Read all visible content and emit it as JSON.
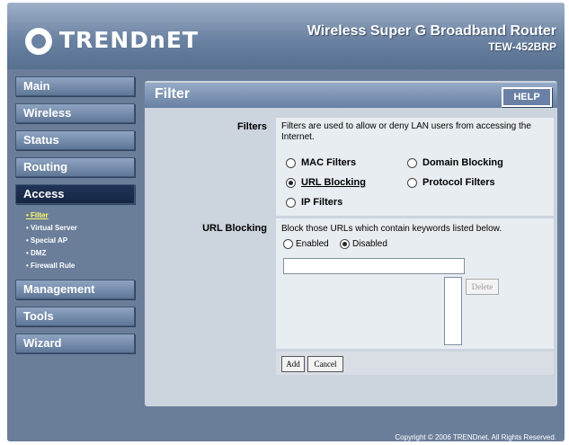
{
  "brand": {
    "logo": "TRENDnET",
    "product": "Wireless Super G Broadband Router",
    "model": "TEW-452BRP"
  },
  "nav": {
    "main": "Main",
    "wireless": "Wireless",
    "status": "Status",
    "routing": "Routing",
    "access": "Access",
    "access_sub": [
      "Filter",
      "Virtual Server",
      "Special AP",
      "DMZ",
      "Firewall Rule"
    ],
    "management": "Management",
    "tools": "Tools",
    "wizard": "Wizard"
  },
  "page": {
    "title": "Filter",
    "help": "HELP"
  },
  "filters": {
    "label": "Filters",
    "description": "Filters are used to allow or deny LAN users from accessing the Internet.",
    "options": {
      "mac": "MAC Filters",
      "domain": "Domain Blocking",
      "url": "URL Blocking",
      "protocol": "Protocol Filters",
      "ip": "IP Filters"
    },
    "selected": "URL Blocking"
  },
  "url_blocking": {
    "label": "URL Blocking",
    "description": "Block those URLs which contain keywords listed below.",
    "enabled_label": "Enabled",
    "disabled_label": "Disabled",
    "state": "Disabled",
    "keyword_value": "",
    "delete": "Delete"
  },
  "actions": {
    "add": "Add",
    "cancel": "Cancel"
  },
  "footer": {
    "copyright": "Copyright © 2006 TRENDnet. All Rights Reserved."
  }
}
